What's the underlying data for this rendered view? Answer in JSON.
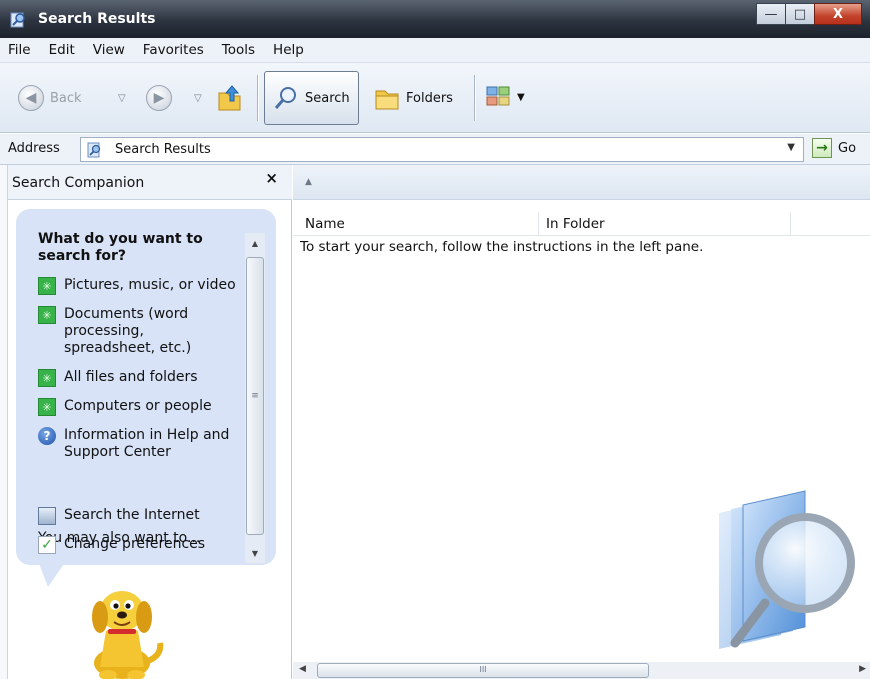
{
  "window": {
    "title": "Search Results",
    "controls": {
      "minimize": "—",
      "maximize": "□",
      "close": "X"
    }
  },
  "menu": [
    "File",
    "Edit",
    "View",
    "Favorites",
    "Tools",
    "Help"
  ],
  "toolbar": {
    "back_label": "Back",
    "search_label": "Search",
    "folders_label": "Folders"
  },
  "address": {
    "label": "Address",
    "value": "Search Results",
    "go_label": "Go"
  },
  "left_pane": {
    "title": "Search Companion",
    "close": "×",
    "question": "What do you want to search for?",
    "options": [
      {
        "label": "Pictures, music, or video",
        "icon": "green-star-icon"
      },
      {
        "label": "Documents (word processing, spreadsheet, etc.)",
        "icon": "green-star-icon"
      },
      {
        "label": "All files and folders",
        "icon": "green-star-icon"
      },
      {
        "label": "Computers or people",
        "icon": "green-star-icon"
      },
      {
        "label": "Information in Help and Support Center",
        "icon": "help-icon"
      }
    ],
    "also_heading": "You may also want to...",
    "also_options": [
      {
        "label": "Search the Internet",
        "icon": "internet-search-icon"
      },
      {
        "label": "Change preferences",
        "icon": "checkmark-icon"
      }
    ]
  },
  "results": {
    "columns": [
      "Name",
      "In Folder"
    ],
    "message": "To start your search, follow the instructions in the left pane."
  },
  "colors": {
    "balloon": "#d8e3f7",
    "titlebar": "#2c3440"
  }
}
